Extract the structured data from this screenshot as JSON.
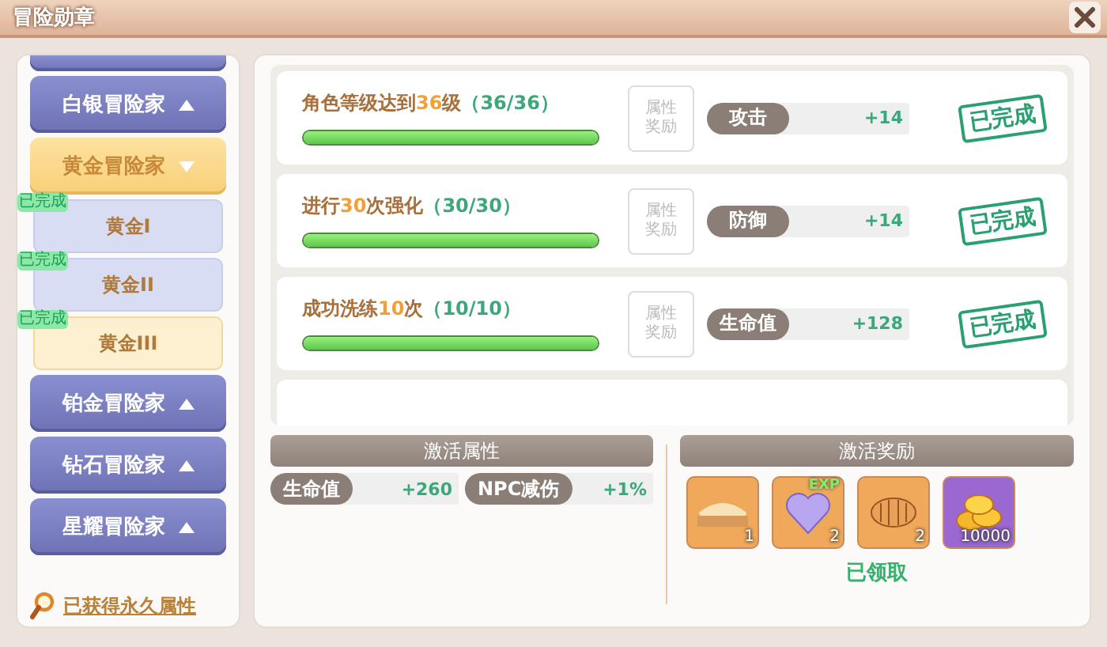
{
  "window": {
    "title": "冒险勋章"
  },
  "sidebar": {
    "groups": [
      {
        "label": "白银冒险家",
        "expanded": false
      },
      {
        "label": "黄金冒险家",
        "expanded": true,
        "children": [
          {
            "label": "黄金I",
            "completed": true,
            "badge": "已完成",
            "selected": false
          },
          {
            "label": "黄金II",
            "completed": true,
            "badge": "已完成",
            "selected": false
          },
          {
            "label": "黄金III",
            "completed": true,
            "badge": "已完成",
            "selected": true
          }
        ]
      },
      {
        "label": "铂金冒险家",
        "expanded": false
      },
      {
        "label": "钻石冒险家",
        "expanded": false
      },
      {
        "label": "星耀冒险家",
        "expanded": false
      }
    ],
    "footer_link": "已获得永久属性"
  },
  "tasks": [
    {
      "text": "角色等级达到",
      "count": "36",
      "unit": "级",
      "progress": "（36/36）",
      "level": 1,
      "reward_label": [
        "属性",
        "奖励"
      ],
      "stat": "攻击",
      "bonus": "+14",
      "completed": true,
      "stamp": "已完成"
    },
    {
      "text": "进行",
      "count": "30",
      "unit": "次强化",
      "progress": "（30/30）",
      "level": 1,
      "reward_label": [
        "属性",
        "奖励"
      ],
      "stat": "防御",
      "bonus": "+14",
      "completed": true,
      "stamp": "已完成"
    },
    {
      "text": "成功洗练",
      "count": "10",
      "unit": "次",
      "progress": "（10/10）",
      "level": 1,
      "reward_label": [
        "属性",
        "奖励"
      ],
      "stat": "生命值",
      "bonus": "+128",
      "completed": true,
      "stamp": "已完成"
    }
  ],
  "activation_attributes": {
    "title": "激活属性",
    "stats": [
      {
        "name": "生命值",
        "value": "+260"
      },
      {
        "name": "NPC减伤",
        "value": "+1%"
      }
    ]
  },
  "activation_rewards": {
    "title": "激活奖励",
    "items": [
      {
        "kind": "banner",
        "count": "1"
      },
      {
        "kind": "exp",
        "count": "2",
        "tag": "EXP"
      },
      {
        "kind": "food",
        "count": "2"
      },
      {
        "kind": "coins",
        "count": "10000"
      }
    ],
    "status": "已领取"
  }
}
